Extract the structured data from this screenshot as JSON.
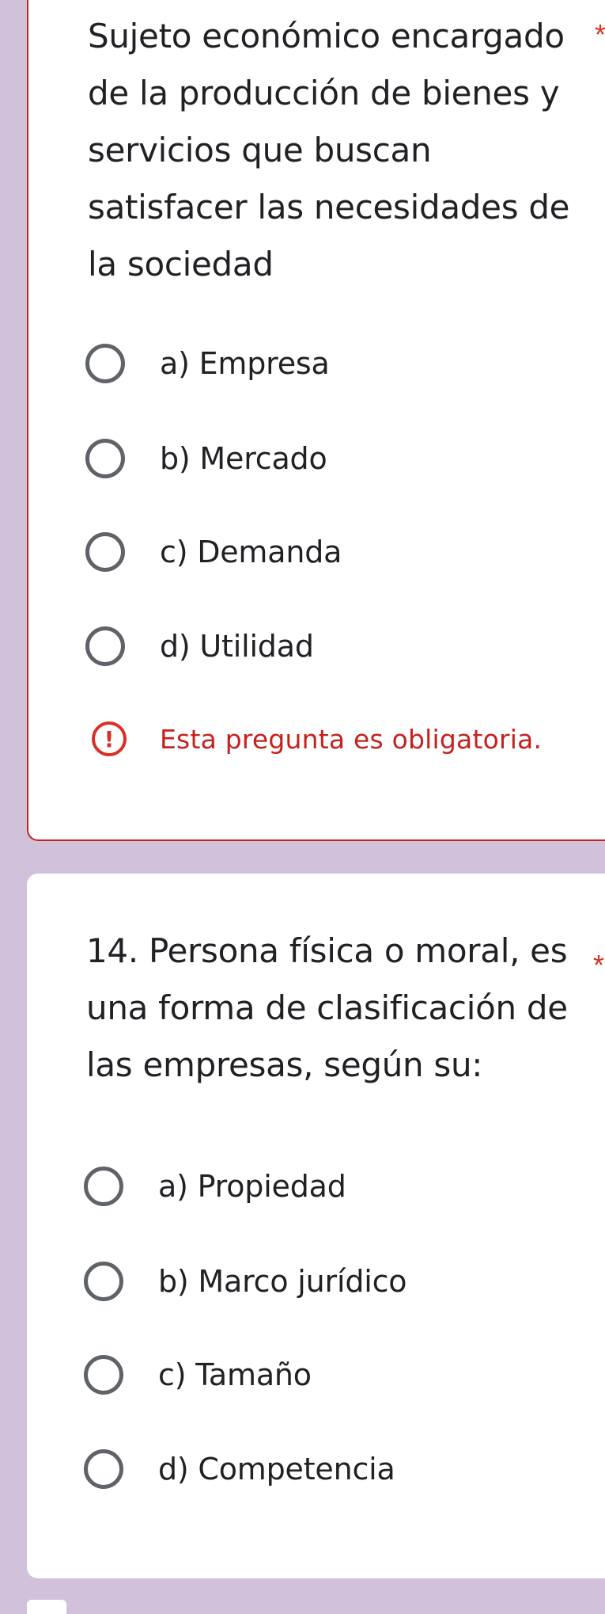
{
  "questions": [
    {
      "text": "Sujeto económico encargado\nde la producción de bienes y\nservicios que buscan\nsatisfacer las necesidades de\nla sociedad",
      "required_marker": "*",
      "options": [
        "a) Empresa",
        "b) Mercado",
        "c) Demanda",
        "d) Utilidad"
      ],
      "error": "Esta pregunta es obligatoria.",
      "error_icon": "!"
    },
    {
      "text": "14. Persona física o moral, es\nuna forma de clasificación de\nlas empresas, según su:",
      "required_marker": "*",
      "options": [
        "a) Propiedad",
        "b) Marco jurídico",
        "c) Tamaño",
        "d) Competencia"
      ]
    }
  ],
  "colors": {
    "page_background": "#d2c1da",
    "error": "#c5221f",
    "radio": "#5f6368",
    "text": "#202124"
  }
}
